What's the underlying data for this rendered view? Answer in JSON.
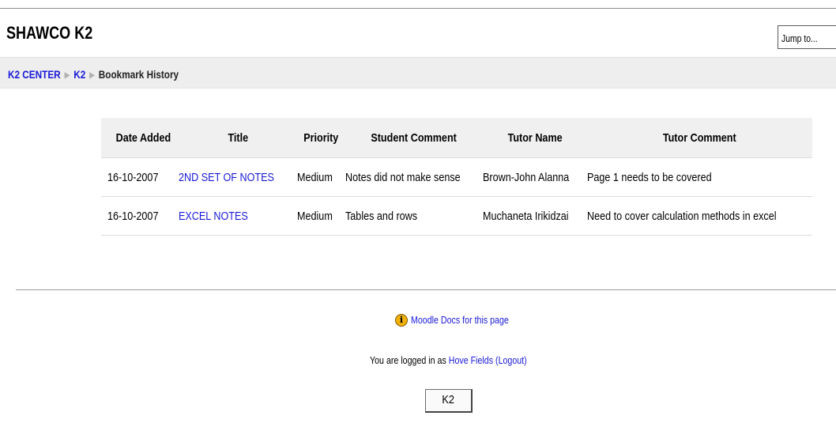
{
  "site": {
    "title": "SHAWCO K2",
    "jump_placeholder": "Jump to..."
  },
  "breadcrumb": {
    "items": [
      "K2 CENTER",
      "K2"
    ],
    "current": "Bookmark History"
  },
  "table": {
    "headers": [
      "Date Added",
      "Title",
      "Priority",
      "Student Comment",
      "Tutor Name",
      "Tutor Comment"
    ],
    "rows": [
      [
        "16-10-2007",
        "2ND SET OF NOTES",
        "Medium",
        "Notes did not make sense",
        "Brown-John Alanna",
        "Page 1 needs to be covered"
      ],
      [
        "16-10-2007",
        "EXCEL NOTES",
        "Medium",
        "Tables and rows",
        "Muchaneta Irikidzai",
        "Need to cover calculation methods in excel"
      ]
    ]
  },
  "footer": {
    "docs_link": "Moodle Docs for this page",
    "logged_in_prefix": "You are logged in as ",
    "user": "Hove Fields",
    "logout": "(Logout)",
    "home_button": "K2"
  },
  "colors": {
    "link": "#1a1ad8",
    "navbar_bg": "#eeeeee",
    "header_bg": "#f0f0f0",
    "info_icon": "#f1b10b"
  }
}
